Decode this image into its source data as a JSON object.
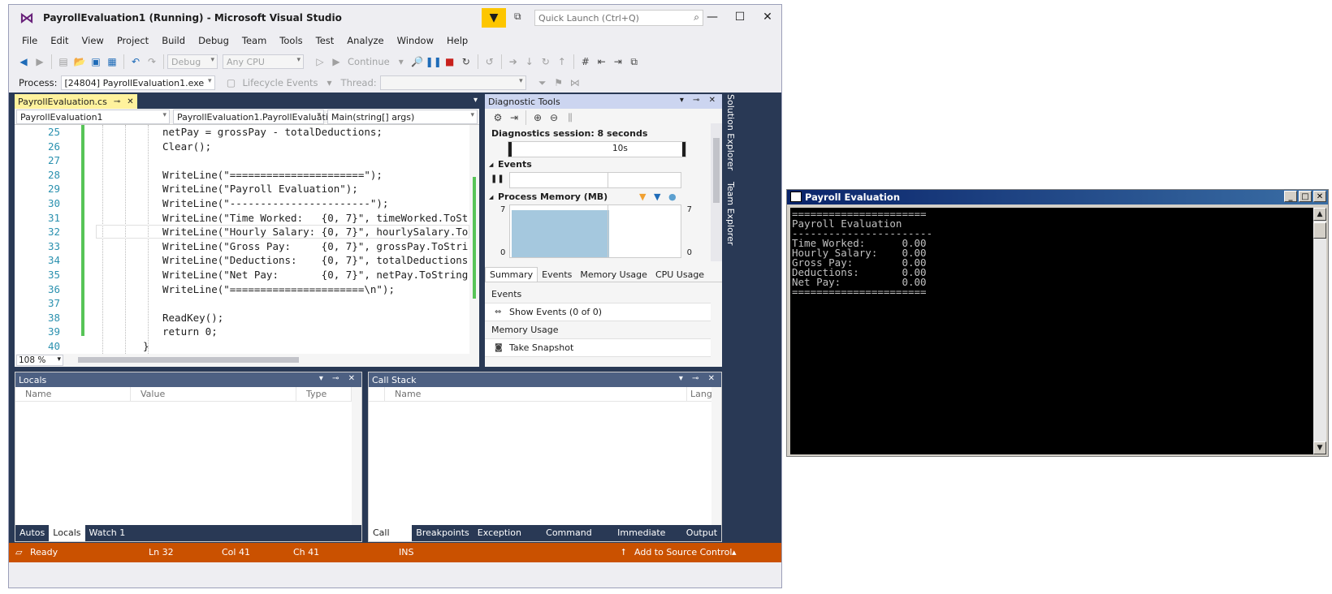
{
  "vs": {
    "title": "PayrollEvaluation1 (Running) - Microsoft Visual Studio",
    "quick_launch_placeholder": "Quick Launch (Ctrl+Q)",
    "menu": [
      "File",
      "Edit",
      "View",
      "Project",
      "Build",
      "Debug",
      "Team",
      "Tools",
      "Test",
      "Analyze",
      "Window",
      "Help"
    ],
    "toolbar": {
      "config": "Debug",
      "platform": "Any CPU",
      "continue_label": "Continue",
      "process_label": "Process:",
      "process_value": "[24804] PayrollEvaluation1.exe",
      "lifecycle_label": "Lifecycle Events",
      "thread_label": "Thread:"
    },
    "editor": {
      "tab_label": "PayrollEvaluation.cs",
      "nav_project": "PayrollEvaluation1",
      "nav_class": "PayrollEvaluation1.PayrollEvaluati",
      "nav_member": "Main(string[] args)",
      "zoom": "108 %",
      "lines": [
        {
          "n": "25",
          "code": "netPay = grossPay - totalDeductions;"
        },
        {
          "n": "26",
          "code": "Clear();"
        },
        {
          "n": "27",
          "code": ""
        },
        {
          "n": "28",
          "code": "WriteLine(\"======================\");"
        },
        {
          "n": "29",
          "code": "WriteLine(\"Payroll Evaluation\");"
        },
        {
          "n": "30",
          "code": "WriteLine(\"-----------------------\");"
        },
        {
          "n": "31",
          "code": "WriteLine(\"Time Worked:   {0, 7}\", timeWorked.ToSt"
        },
        {
          "n": "32",
          "code": "WriteLine(\"Hourly Salary: {0, 7}\", hourlySalary.To"
        },
        {
          "n": "33",
          "code": "WriteLine(\"Gross Pay:     {0, 7}\", grossPay.ToStri"
        },
        {
          "n": "34",
          "code": "WriteLine(\"Deductions:    {0, 7}\", totalDeductions"
        },
        {
          "n": "35",
          "code": "WriteLine(\"Net Pay:       {0, 7}\", netPay.ToString"
        },
        {
          "n": "36",
          "code": "WriteLine(\"======================\\n\");"
        },
        {
          "n": "37",
          "code": ""
        },
        {
          "n": "38",
          "code": "ReadKey();"
        },
        {
          "n": "39",
          "code": "return 0;"
        },
        {
          "n": "40",
          "code": "}"
        }
      ]
    },
    "diagnostics": {
      "title": "Diagnostic Tools",
      "session": "Diagnostics session: 8 seconds",
      "tick": "10s",
      "events_label": "Events",
      "memory_label": "Process Memory (MB)",
      "y_max": "7",
      "y_min": "0",
      "tabs": [
        "Summary",
        "Events",
        "Memory Usage",
        "CPU Usage"
      ],
      "summary_events_head": "Events",
      "show_events": "Show Events (0 of 0)",
      "memory_usage_head": "Memory Usage",
      "take_snapshot": "Take Snapshot"
    },
    "side_tabs": [
      "Solution Explorer",
      "Team Explorer"
    ],
    "locals": {
      "title": "Locals",
      "columns": [
        "Name",
        "Value",
        "Type"
      ],
      "tabs": [
        "Autos",
        "Locals",
        "Watch 1"
      ]
    },
    "callstack": {
      "title": "Call Stack",
      "columns": [
        "Name",
        "Lang"
      ],
      "tabs": [
        "Call Stack",
        "Breakpoints",
        "Exception Setti...",
        "Command Wind...",
        "Immediate Win...",
        "Output"
      ]
    },
    "status": {
      "ready": "Ready",
      "ln": "Ln 32",
      "col": "Col 41",
      "ch": "Ch 41",
      "ins": "INS",
      "source_control": "Add to Source Control"
    }
  },
  "console": {
    "title": "Payroll Evaluation",
    "lines": [
      "======================",
      "Payroll Evaluation",
      "-----------------------",
      "Time Worked:      0.00",
      "Hourly Salary:    0.00",
      "Gross Pay:        0.00",
      "Deductions:       0.00",
      "Net Pay:          0.00",
      "======================"
    ]
  }
}
